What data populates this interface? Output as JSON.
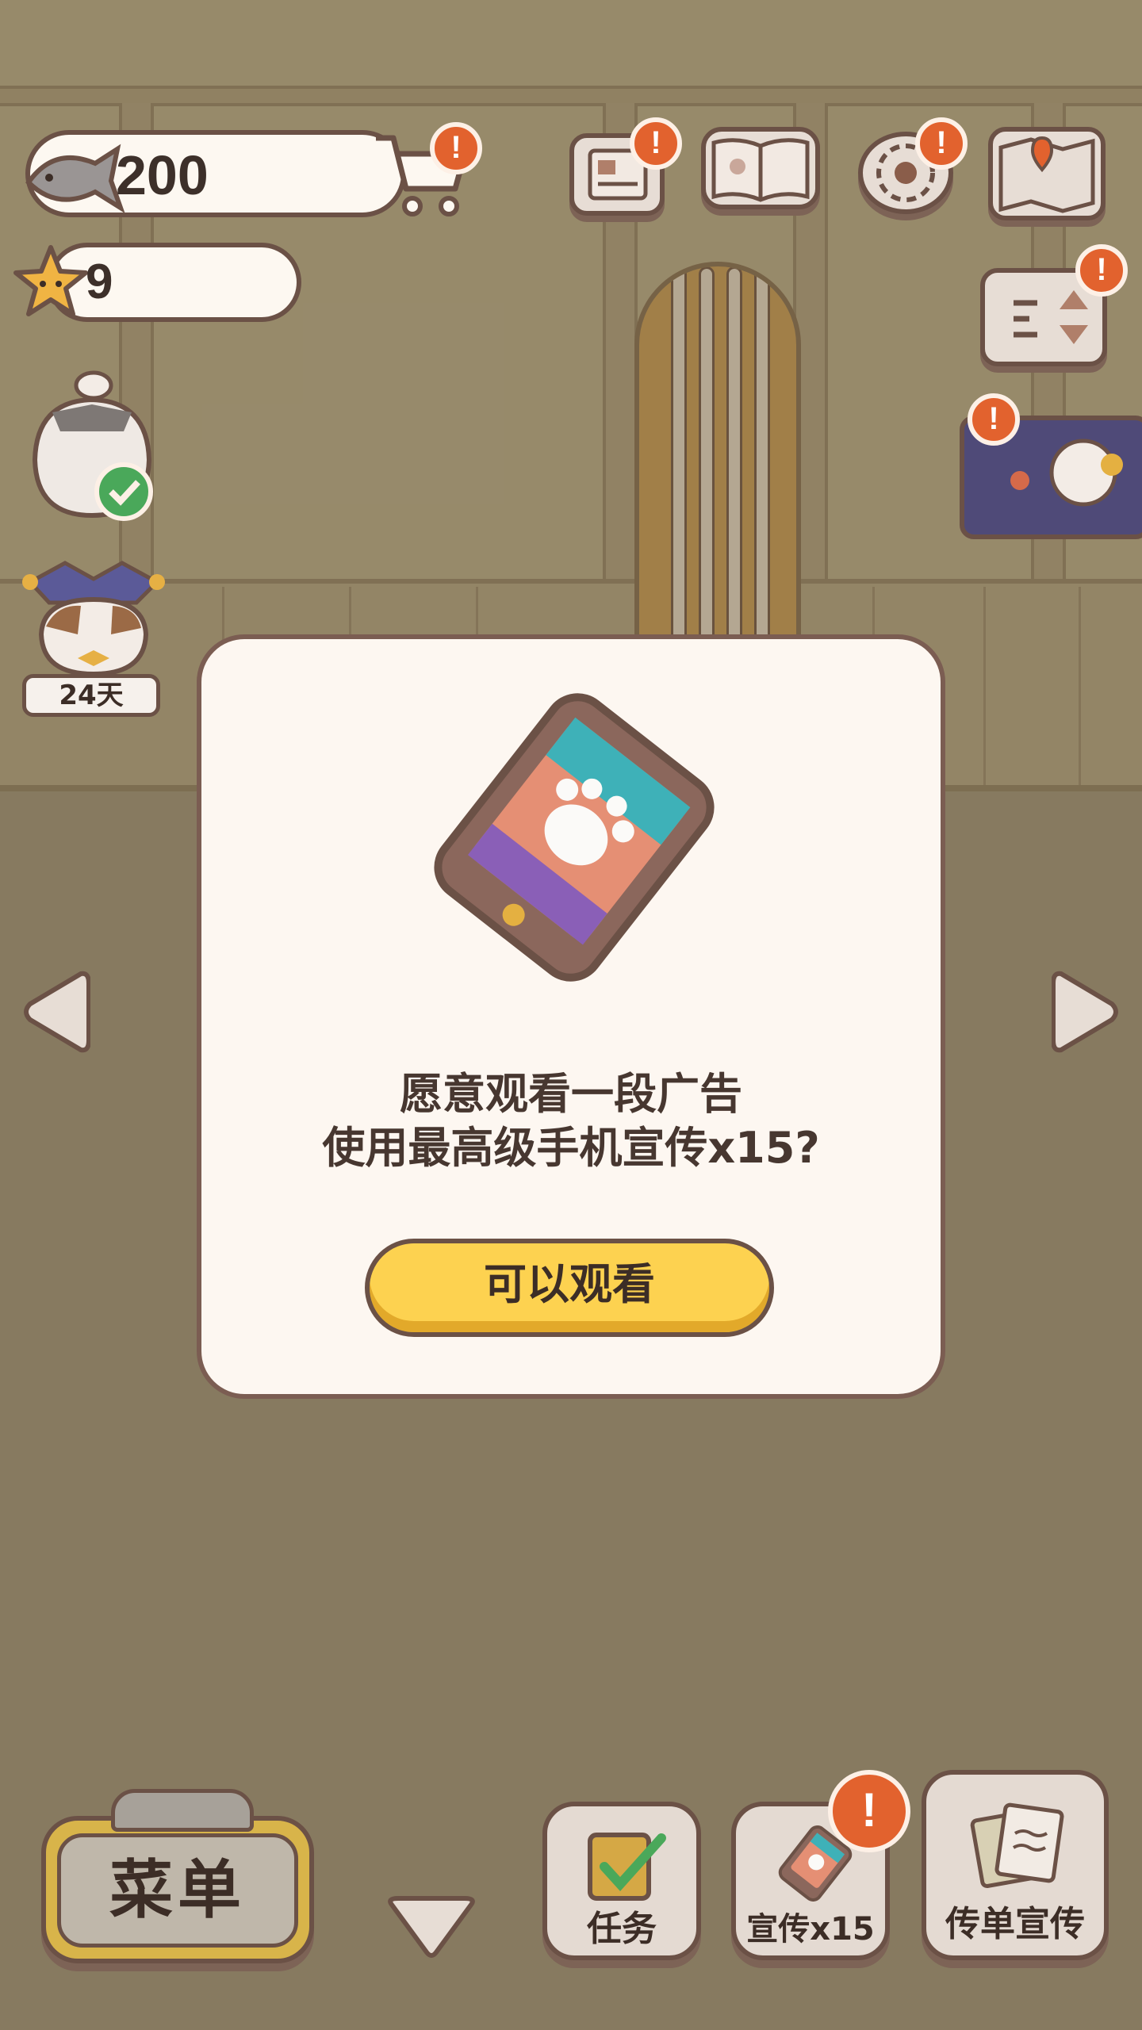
{
  "hud": {
    "fish_count": "200",
    "star_count": "9",
    "cat_day_badge": "24天"
  },
  "modal": {
    "message_line1": "愿意观看一段广告",
    "message_line2": "使用最高级手机宣传x15?",
    "watch_button_label": "可以观看"
  },
  "bottom_bar": {
    "menu_label": "菜单",
    "tasks_label": "任务",
    "promo_label": "宣传x15",
    "flyer_label": "传单宣传"
  },
  "icons": {
    "alert": "!",
    "nav": [
      "chevron-left-icon",
      "chevron-right-icon",
      "chevron-down-icon"
    ]
  },
  "colors": {
    "alert": "#e2622e",
    "watch_button": "#fdd250",
    "menu_button": "#d8b44a",
    "modal_bg": "#fdf7f1",
    "outline": "#6b5146"
  }
}
